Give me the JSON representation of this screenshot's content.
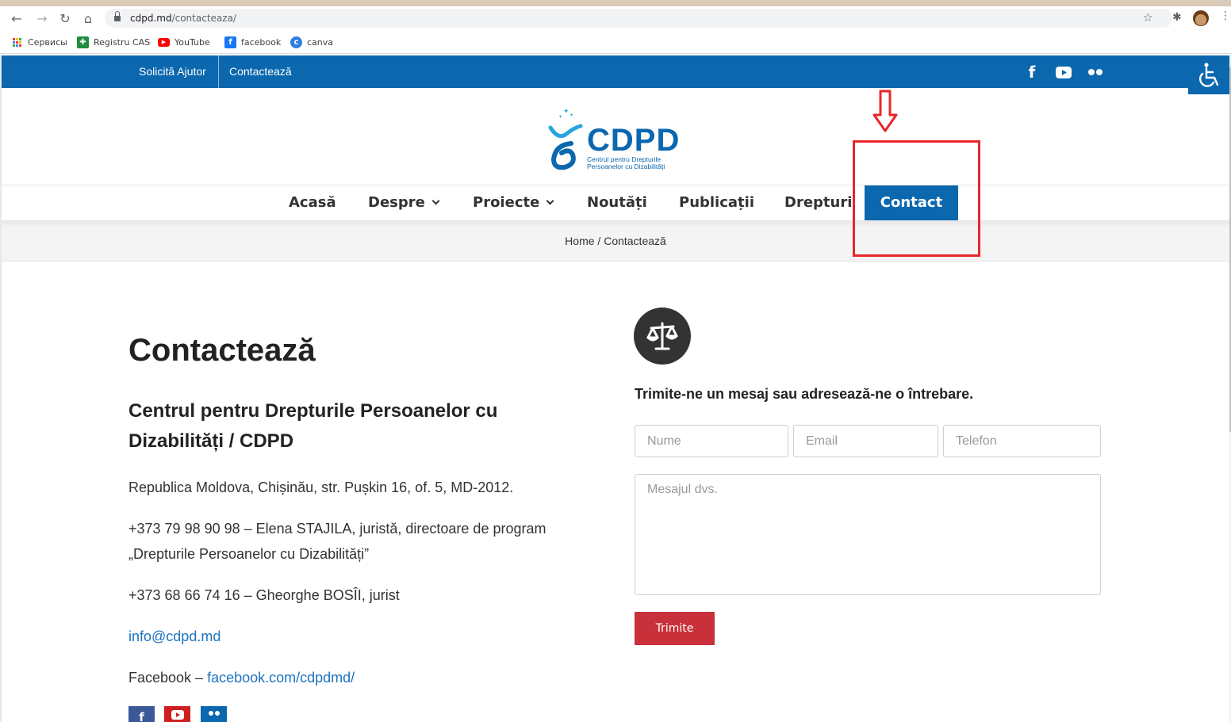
{
  "browser": {
    "url_host": "cdpd.md",
    "url_path": "/contacteaza/",
    "bookmarks": [
      {
        "label": "Сервисы",
        "icon": "apps-grid-icon"
      },
      {
        "label": "Registru CAS",
        "icon": "registru-icon"
      },
      {
        "label": "YouTube",
        "icon": "youtube-icon"
      },
      {
        "label": "facebook",
        "icon": "facebook-icon"
      },
      {
        "label": "canva",
        "icon": "canva-icon"
      }
    ]
  },
  "topbar": {
    "links": [
      "Solicită Ajutor",
      "Contactează"
    ],
    "social": [
      "facebook-icon",
      "youtube-icon",
      "flickr-icon"
    ],
    "color": "#0b67ae"
  },
  "logo": {
    "name": "CDPD",
    "subtitle_line1": "Centrul pentru Drepturile",
    "subtitle_line2": "Persoanelor cu Dizabilități"
  },
  "nav": {
    "items": [
      "Acasă",
      "Despre",
      "Proiecte",
      "Noutăți",
      "Publicații",
      "Drepturi"
    ],
    "active": "Contact"
  },
  "breadcrumb": {
    "home": "Home",
    "sep": "/",
    "current": "Contactează"
  },
  "contact": {
    "title": "Contactează",
    "org": "Centrul pentru Drepturile Persoanelor cu Dizabilități / CDPD",
    "address": "Republica Moldova, Chișinău, str. Pușkin 16, of. 5, MD-2012.",
    "phone1_line1": "+373 79 98 90 98 – Elena STAJILA, juristă, directoare de program",
    "phone1_line2": "„Drepturile Persoanelor cu Dizabilități”",
    "phone2": "+373 68 66 74 16 – Gheorghe BOSÎI, jurist",
    "email": "info@cdpd.md",
    "facebook_label": "Facebook – ",
    "facebook_link": "facebook.com/cdpdmd/"
  },
  "form": {
    "title": "Trimite-ne un mesaj sau adresează-ne o întrebare.",
    "name_placeholder": "Nume",
    "email_placeholder": "Email",
    "phone_placeholder": "Telefon",
    "message_placeholder": "Mesajul dvs.",
    "submit_label": "Trimite",
    "submit_color": "#c8313a"
  },
  "annotation_color": "#e8262a"
}
